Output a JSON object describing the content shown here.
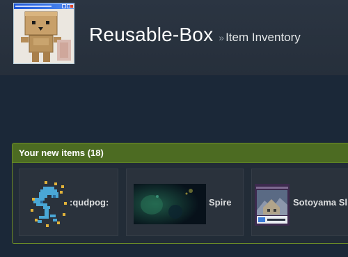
{
  "profile": {
    "name": "Reusable-Box",
    "breadcrumb_separator": "»",
    "page_title": "Item Inventory",
    "avatar_icon": "cardboard-box-robot-avatar"
  },
  "new_items": {
    "title": "Your new items (18)",
    "accent_color": "#4c6b22",
    "items": [
      {
        "label": ":qudpog:",
        "icon": "pixel-creature-emoticon"
      },
      {
        "label": "Spire",
        "icon": "dark-map-background"
      },
      {
        "label": "Sotoyama Sl",
        "icon": "trading-card-mountain-house"
      }
    ]
  }
}
